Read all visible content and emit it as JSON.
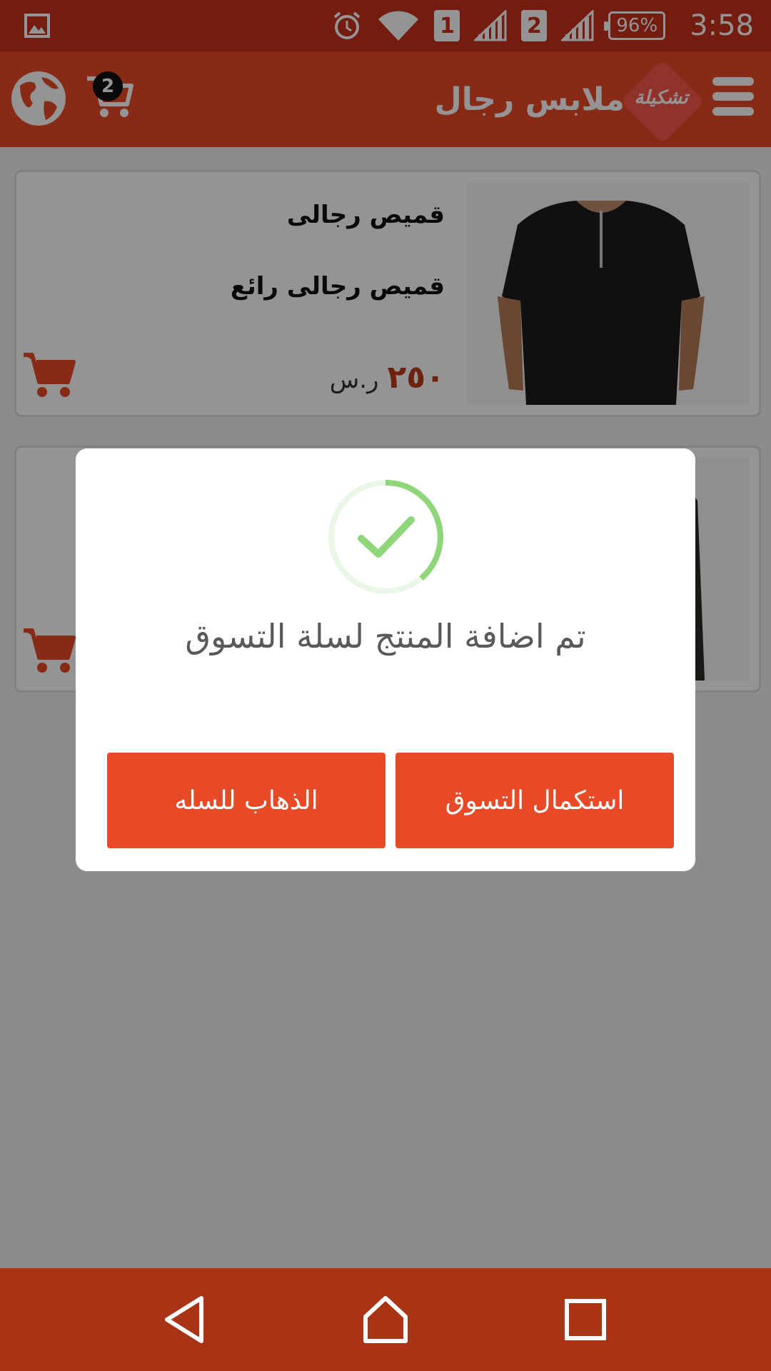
{
  "status_bar": {
    "sim1": "1",
    "sim2": "2",
    "battery": "96%",
    "time": "3:58"
  },
  "app_bar": {
    "title": "ملابس رجال",
    "logo_text": "تشكيلة",
    "cart_count": "2"
  },
  "products": [
    {
      "name": "قميص رجالى",
      "description": "قميص رجالى رائع",
      "price": "٢٥٠",
      "currency": "ر.س"
    },
    {
      "name": "",
      "description": "",
      "price": "",
      "currency": ""
    }
  ],
  "dialog": {
    "message": "تم اضافة المنتج لسلة التسوق",
    "go_to_cart_label": "الذهاب للسله",
    "continue_shopping_label": "استكمال التسوق"
  },
  "colors": {
    "primary": "#e84a27",
    "status_bar": "#c8311a",
    "nav_bar": "#a83315",
    "success": "#8fd67a"
  }
}
